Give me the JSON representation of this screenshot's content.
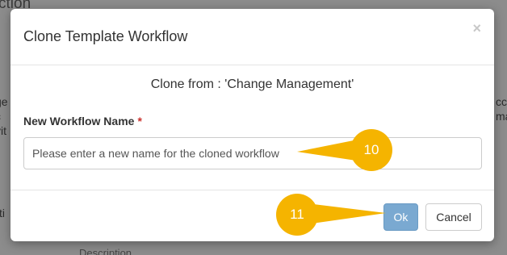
{
  "background": {
    "fragments": {
      "top": "ction",
      "left_1": "ge",
      "left_2": "c",
      "left_3": "vit",
      "left_4": "cti",
      "right_1": "ccu",
      "right_2": "ma",
      "bottom": "Description"
    }
  },
  "modal": {
    "title": "Clone Template Workflow",
    "close_glyph": "×",
    "clone_from": "Clone from : 'Change Management'",
    "field_label": "New Workflow Name",
    "required_marker": "*",
    "input_value": "",
    "input_placeholder": "Please enter a new name for the cloned workflow",
    "ok_label": "Ok",
    "cancel_label": "Cancel"
  },
  "callouts": [
    {
      "number": "10",
      "target": "new-workflow-name-input"
    },
    {
      "number": "11",
      "target": "ok-button"
    }
  ],
  "colors": {
    "callout": "#f5b400",
    "ok_button": "#7aa9d1",
    "required": "#c9302c",
    "overlay": "#8c8c8c"
  },
  "icons": {
    "close": "close-icon"
  }
}
